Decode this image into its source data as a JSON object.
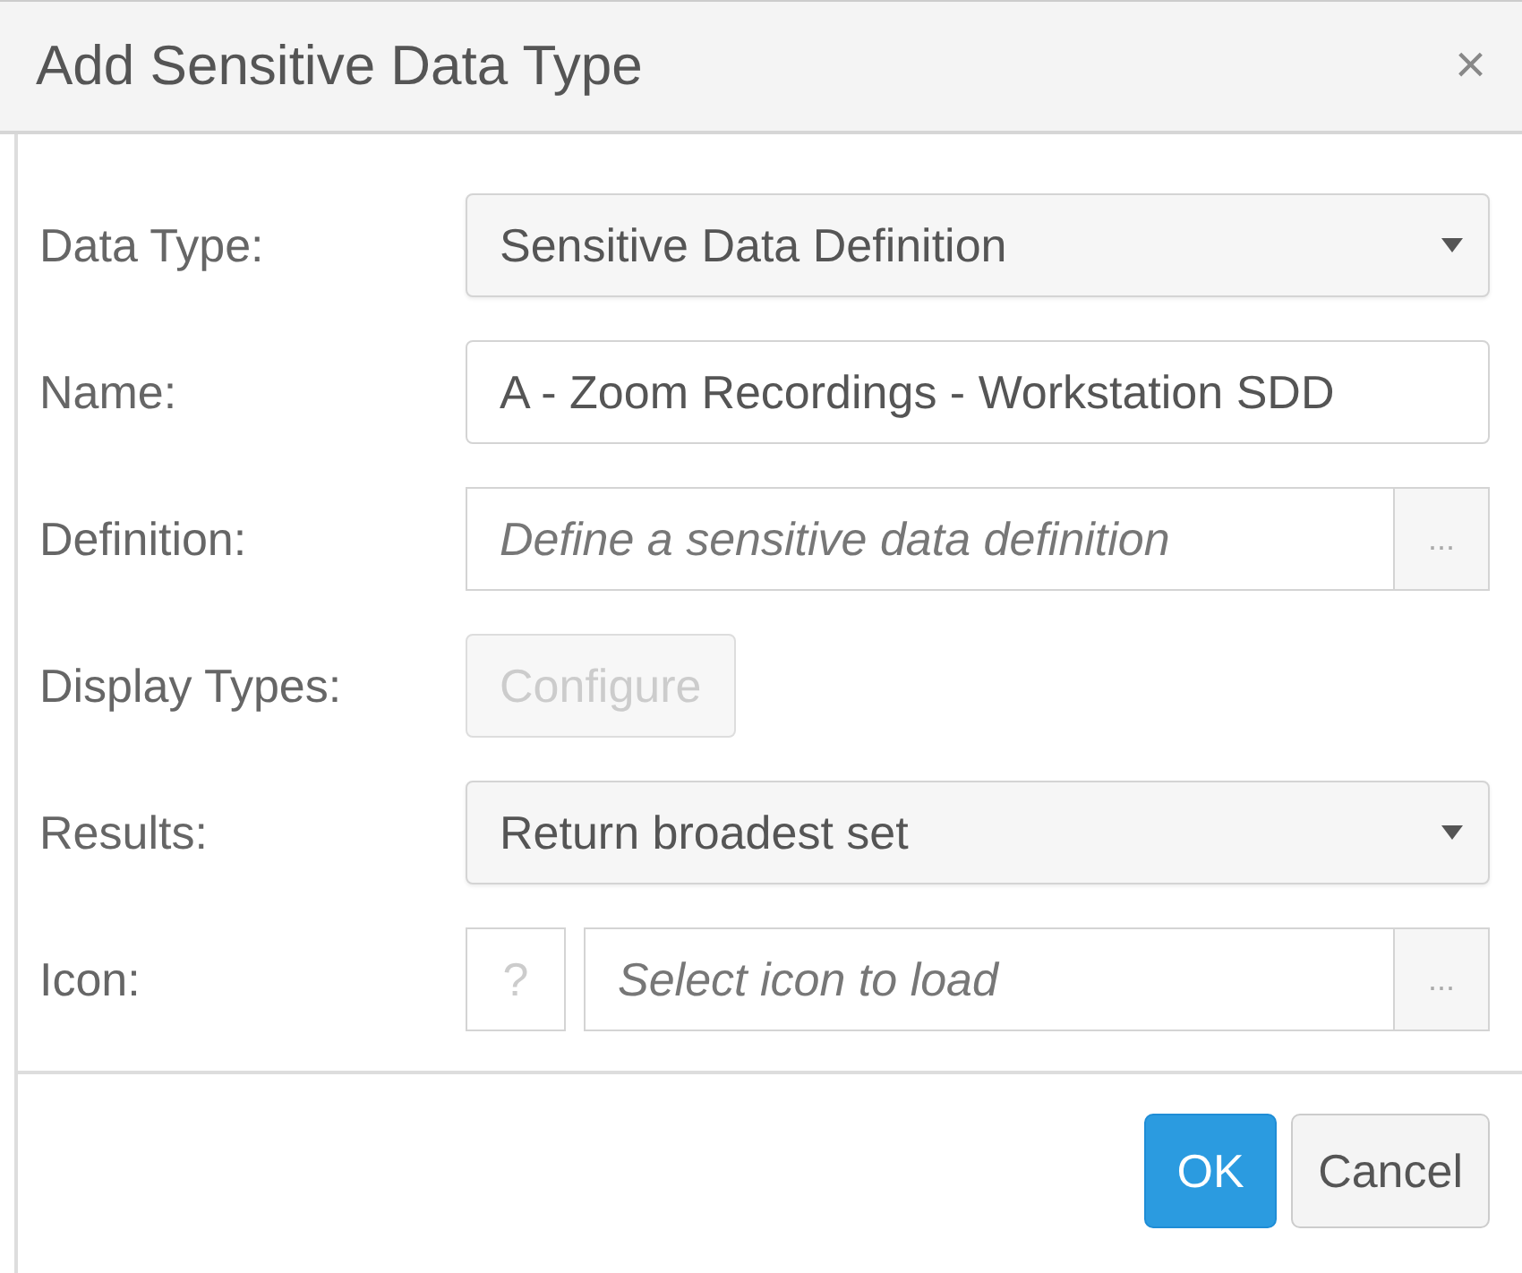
{
  "dialog": {
    "title": "Add Sensitive Data Type",
    "close": "×"
  },
  "fields": [
    {
      "kind": "select",
      "label": "Data Type:",
      "value": "Sensitive Data Definition"
    },
    {
      "kind": "text",
      "label": "Name:",
      "value": "A - Zoom Recordings - Workstation SDD"
    },
    {
      "kind": "picker",
      "label": "Definition:",
      "placeholder": "Define a sensitive data definition",
      "browse": "..."
    },
    {
      "kind": "button",
      "label": "Display Types:",
      "button": "Configure",
      "disabled": true
    },
    {
      "kind": "select",
      "label": "Results:",
      "value": "Return broadest set"
    },
    {
      "kind": "icon-picker",
      "label": "Icon:",
      "icon": "?",
      "placeholder": "Select icon to load",
      "browse": "..."
    }
  ],
  "buttons": [
    {
      "label": "OK",
      "primary": true
    },
    {
      "label": "Cancel",
      "primary": false
    }
  ]
}
